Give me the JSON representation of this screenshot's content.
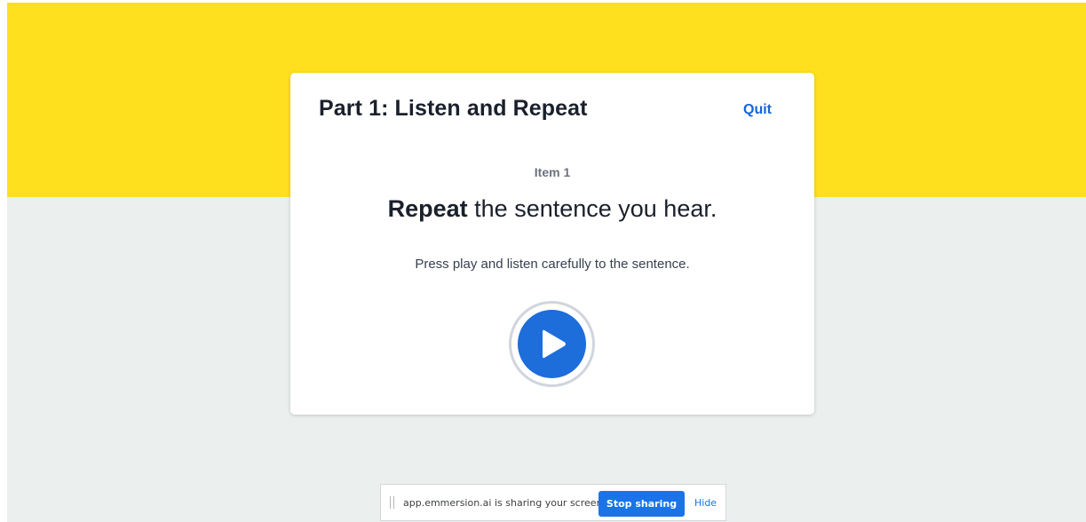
{
  "card": {
    "title": "Part 1: Listen and Repeat",
    "quit_label": "Quit",
    "item_label": "Item 1",
    "instruction_bold": "Repeat",
    "instruction_rest": " the sentence you hear.",
    "subtext": "Press play and listen carefully to the sentence."
  },
  "play_button": {
    "icon": "play-icon"
  },
  "share_bar": {
    "message": "app.emmersion.ai is sharing your screen.",
    "stop_label": "Stop sharing",
    "hide_label": "Hide"
  },
  "colors": {
    "banner_yellow": "#ffe01e",
    "page_background": "#ebf0ef",
    "accent_blue": "#1d6ddb",
    "stop_button_blue": "#1a73e8"
  }
}
